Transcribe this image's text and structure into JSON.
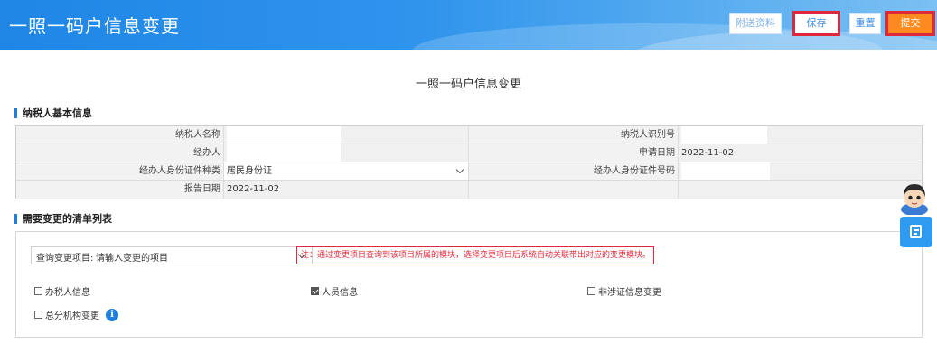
{
  "header": {
    "title": "一照一码户信息变更",
    "buttons": {
      "attach": "附送资料",
      "save": "保存",
      "reset": "重置",
      "submit": "提交"
    },
    "highlight_color": "#e0283a",
    "accent_color": "#1f86e6"
  },
  "page_title": "一照一码户信息变更",
  "basic_info": {
    "section_title": "纳税人基本信息",
    "rows": [
      {
        "label_left": "纳税人名称",
        "value_left": "",
        "label_right": "纳税人识别号",
        "value_right": ""
      },
      {
        "label_left": "经办人",
        "value_left": "",
        "label_right": "申请日期",
        "value_right": "2022-11-02"
      },
      {
        "label_left": "经办人身份证件种类",
        "value_left": "居民身份证",
        "label_right": "经办人身份证件号码",
        "value_right": ""
      },
      {
        "label_left": "报告日期",
        "value_left": "2022-11-02",
        "label_right": "",
        "value_right": ""
      }
    ]
  },
  "change_list": {
    "section_title": "需要变更的清单列表",
    "query_label": "查询变更项目:",
    "query_placeholder": "请输入变更的项目",
    "hint": "注：通过变更项目查询到该项目所属的模块，选择变更项目后系统自动关联带出对应的变更模块。",
    "options": [
      {
        "label": "办税人信息",
        "checked": false
      },
      {
        "label": "人员信息",
        "checked": true
      },
      {
        "label": "非涉证信息变更",
        "checked": false
      },
      {
        "label": "总分机构变更",
        "checked": false
      }
    ]
  },
  "icons": {
    "info": "info-icon",
    "assistant": "assistant-avatar-icon",
    "side": "document-icon"
  }
}
